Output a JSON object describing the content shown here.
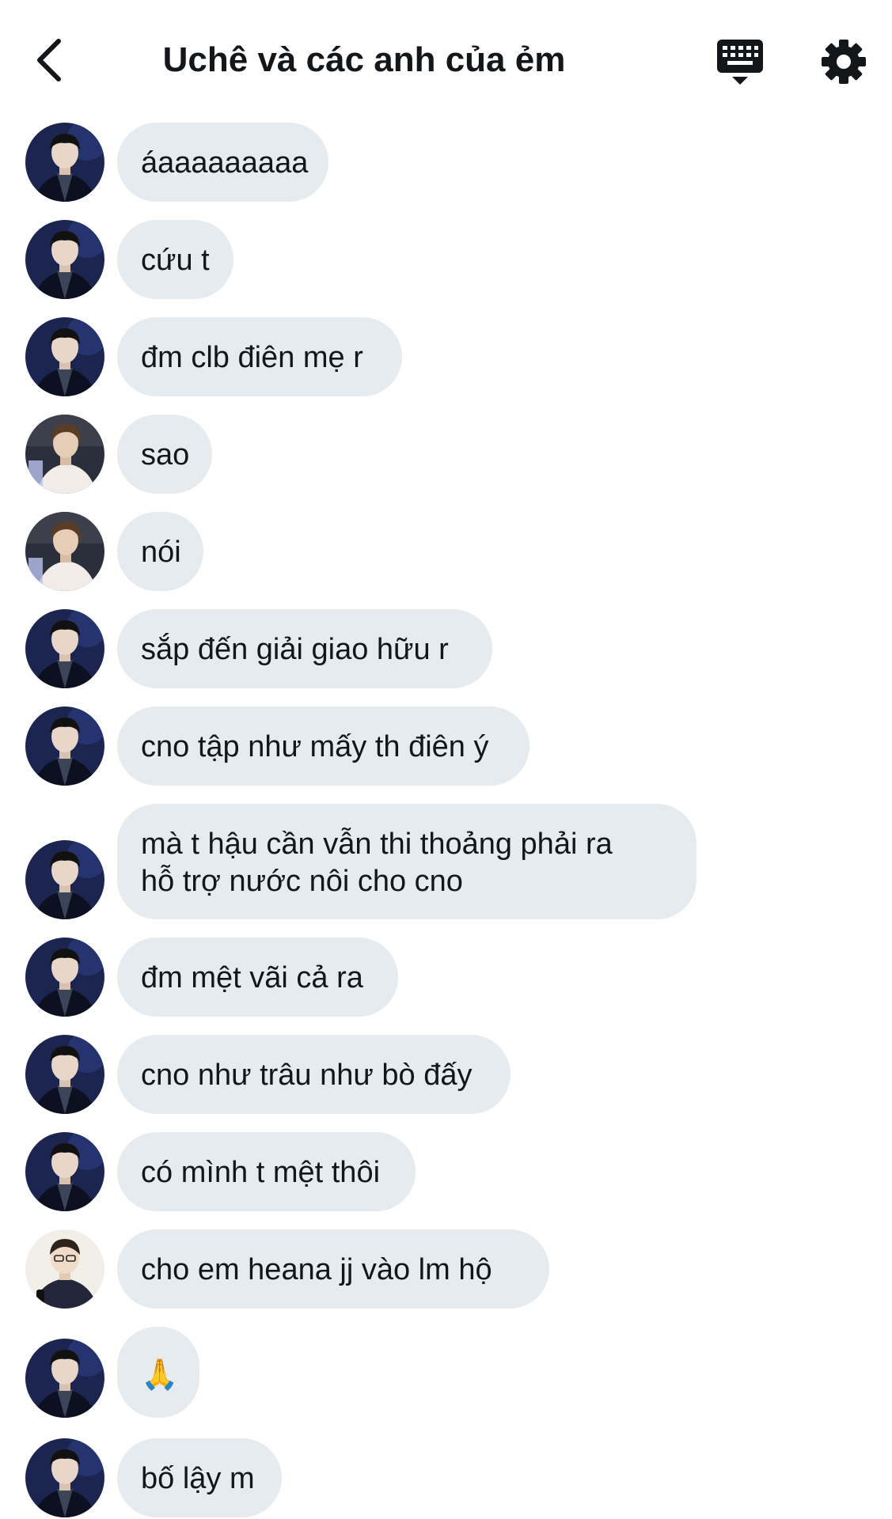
{
  "header": {
    "title": "Uchê và các anh của ẻm",
    "back_icon": "chevron-left-icon",
    "keyboard_icon": "keyboard-icon",
    "settings_icon": "gear-icon"
  },
  "colors": {
    "bubble": "#e6ebf0",
    "text": "#14171a",
    "background": "#ffffff"
  },
  "messages": [
    {
      "sender": "user-a",
      "text": "áaaaaaaaaa"
    },
    {
      "sender": "user-a",
      "text": "cứu t"
    },
    {
      "sender": "user-a",
      "text": "đm clb điên mẹ r"
    },
    {
      "sender": "user-b",
      "text": "sao"
    },
    {
      "sender": "user-b",
      "text": "nói"
    },
    {
      "sender": "user-a",
      "text": "sắp đến giải giao hữu r"
    },
    {
      "sender": "user-a",
      "text": "cno tập như mấy th điên ý"
    },
    {
      "sender": "user-a",
      "lines": [
        "mà t hậu cần vẫn thi thoảng phải ra",
        "hỗ trợ nước nôi cho cno"
      ]
    },
    {
      "sender": "user-a",
      "text": "đm mệt vãi cả ra"
    },
    {
      "sender": "user-a",
      "text": "cno như trâu như bò đấy"
    },
    {
      "sender": "user-a",
      "text": "có mình t mệt thôi"
    },
    {
      "sender": "user-c",
      "text": "cho em heana jj vào lm hộ"
    },
    {
      "sender": "user-a",
      "text": "🙏"
    },
    {
      "sender": "user-a",
      "text": "bố lậy m"
    }
  ]
}
